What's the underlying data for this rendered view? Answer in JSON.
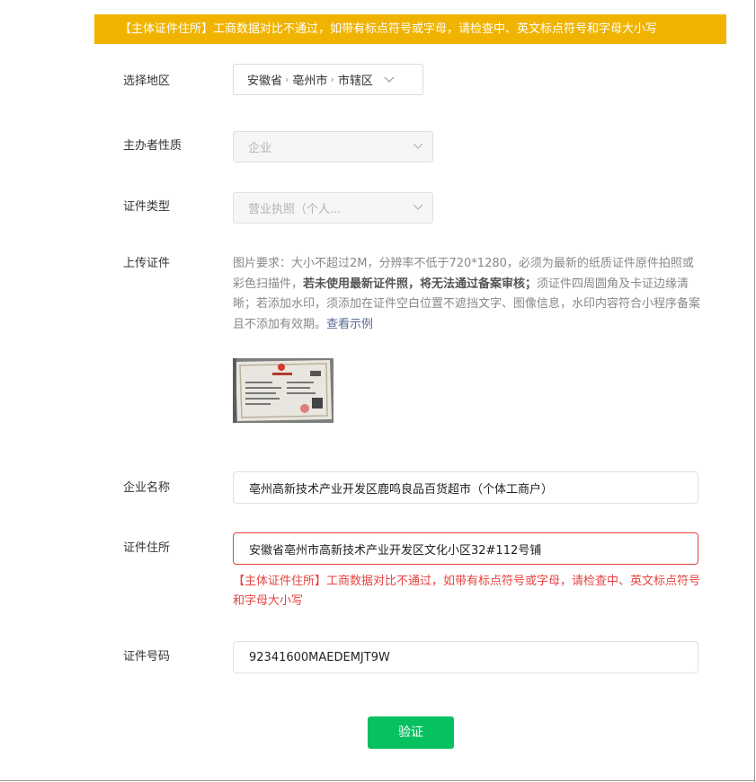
{
  "banner": {
    "text": "【主体证件住所】工商数据对比不通过，如带有标点符号或字母，请检查中、英文标点符号和字母大小写"
  },
  "form": {
    "region": {
      "label": "选择地区",
      "province": "安徽省",
      "city": "亳州市",
      "district": "市辖区",
      "chevron_icon": "chevron-down-icon"
    },
    "sponsor_type": {
      "label": "主办者性质",
      "value": "企业"
    },
    "cert_type": {
      "label": "证件类型",
      "value": "营业执照（个人..."
    },
    "upload": {
      "label": "上传证件",
      "desc_part1": "图片要求：大小不超过2M，分辨率不低于720*1280，必须为最新的纸质证件原件拍照或彩色扫描件，",
      "desc_bold": "若未使用最新证件照，将无法通过备案审核；",
      "desc_part2": "须证件四周圆角及卡证边缘清晰；若添加水印，须添加在证件空白位置不遮挡文字、图像信息，水印内容符合小程序备案且不添加有效期。",
      "example_link": "查看示例"
    },
    "company_name": {
      "label": "企业名称",
      "value": "亳州高新技术产业开发区鹿鸣良品百货超市（个体工商户）"
    },
    "cert_address": {
      "label": "证件住所",
      "value": "安徽省亳州市高新技术产业开发区文化小区32#112号铺",
      "error": "【主体证件住所】工商数据对比不通过，如带有标点符号或字母，请检查中、英文标点符号和字母大小写"
    },
    "cert_number": {
      "label": "证件号码",
      "value": "92341600MAEDEMJT9W"
    }
  },
  "verify_button": {
    "label": "验证"
  },
  "colors": {
    "banner_bg": "#f0b400",
    "error": "#e64340",
    "primary": "#07c160",
    "link": "#576b95"
  }
}
